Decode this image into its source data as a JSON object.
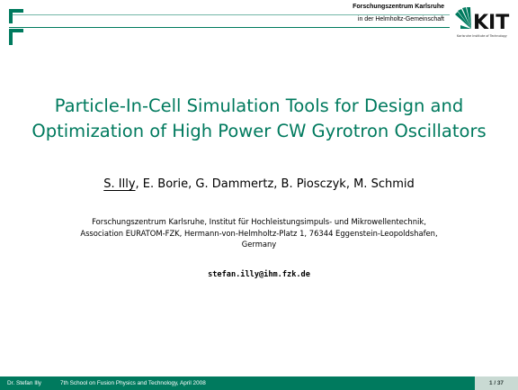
{
  "header": {
    "institution": "Forschungszentrum Karlsruhe",
    "institution_sub": "in der Helmholtz-Gemeinschaft",
    "logo": {
      "wordmark": "KIT",
      "tagline": "Karlsruhe Institute of Technology"
    }
  },
  "slide": {
    "title_line1": "Particle-In-Cell Simulation Tools for Design and",
    "title_line2": "Optimization of High Power CW Gyrotron Oscillators",
    "presenter": "S. Illy",
    "coauthors": ", E. Borie, G. Dammertz, B. Piosczyk, M. Schmid",
    "affiliation_line1": "Forschungszentrum Karlsruhe, Institut für Hochleistungsimpuls- und Mikrowellentechnik,",
    "affiliation_line2": "Association EURATOM-FZK, Hermann-von-Helmholtz-Platz 1, 76344 Eggenstein-Leopoldshafen,",
    "affiliation_line3": "Germany",
    "email": "stefan.illy@ihm.fzk.de"
  },
  "footer": {
    "author": "Dr. Stefan Illy",
    "event": "7th School on Fusion Physics and Technology, April 2008",
    "page": "1 / 37"
  },
  "colors": {
    "accent": "#007a5e",
    "page_box": "#c9dad3"
  }
}
